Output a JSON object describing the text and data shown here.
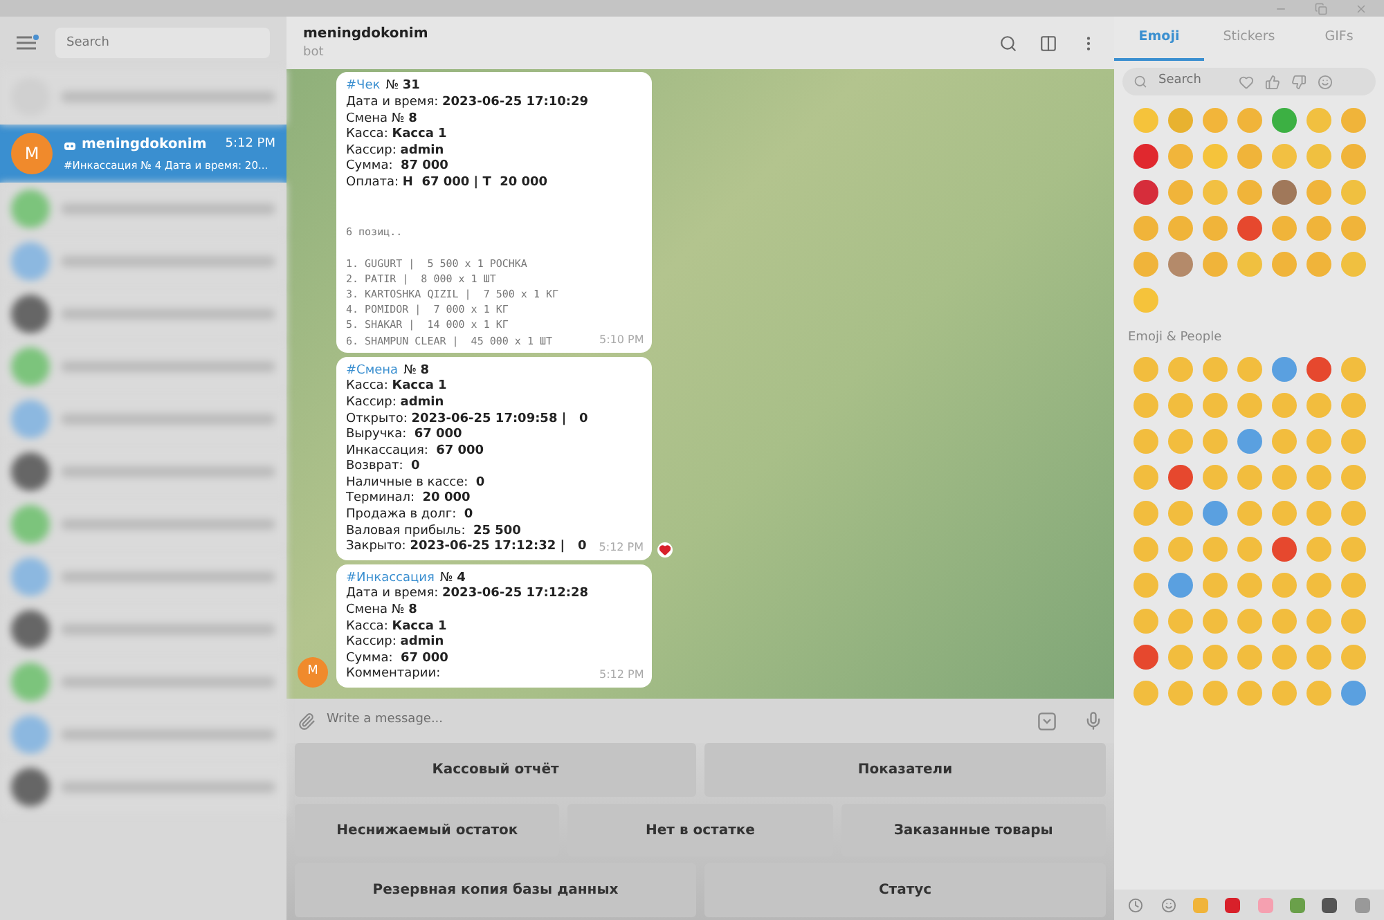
{
  "sidebar": {
    "search": {
      "placeholder": "Search"
    },
    "chats": [
      {
        "name": "meningdokonim",
        "avatar": "M",
        "time": "5:12 PM",
        "preview": "#Инкассация № 4 Дата и время: 20...",
        "selected": true
      }
    ]
  },
  "chat": {
    "title": "meningdokonim",
    "subtitle": "bot",
    "messages": [
      {
        "hashtag": "#Чек",
        "lines": [
          {
            "kind": "text",
            "text": "№ **31**"
          },
          {
            "kind": "text",
            "text": "Дата и время: **2023-06-25 17:10:29**"
          },
          {
            "kind": "text",
            "text": "Смена № **8**"
          },
          {
            "kind": "text",
            "text": "Касса: **Касса 1**"
          },
          {
            "kind": "text",
            "text": "Кассир: **admin**"
          },
          {
            "kind": "text",
            "text": "Сумма:  **87 000**"
          },
          {
            "kind": "text",
            "text": "Оплата: **Н  67 000 | Т  20 000**"
          },
          {
            "kind": "blank"
          },
          {
            "kind": "blank"
          },
          {
            "kind": "mono",
            "text": "6 позиц.."
          },
          {
            "kind": "blank"
          },
          {
            "kind": "mono",
            "text": "1. GUGURT |  5 500 x 1 РОСНКА"
          },
          {
            "kind": "mono",
            "text": "2. PATIR |  8 000 x 1 ШТ"
          },
          {
            "kind": "mono",
            "text": "3. KARTOSHKA QIZIL |  7 500 x 1 КГ"
          },
          {
            "kind": "mono",
            "text": "4. POMIDOR |  7 000 x 1 КГ"
          },
          {
            "kind": "mono",
            "text": "5. SHAKAR |  14 000 x 1 КГ"
          },
          {
            "kind": "mono",
            "text": "6. SHAMPUN CLEAR |  45 000 x 1 ШТ"
          }
        ],
        "time": "5:10 PM",
        "reaction": false
      },
      {
        "hashtag": "#Смена",
        "lines": [
          {
            "kind": "text",
            "text": "№ **8**"
          },
          {
            "kind": "text",
            "text": "Касса: **Касса 1**"
          },
          {
            "kind": "text",
            "text": "Кассир: **admin**"
          },
          {
            "kind": "text",
            "text": "Открыто: **2023-06-25 17:09:58 |   0**"
          },
          {
            "kind": "text",
            "text": "Выручка:  **67 000**"
          },
          {
            "kind": "text",
            "text": "Инкассация:  **67 000**"
          },
          {
            "kind": "text",
            "text": "Возврат:  **0**"
          },
          {
            "kind": "text",
            "text": "Наличные в кассе:  **0**"
          },
          {
            "kind": "text",
            "text": "Терминал:  **20 000**"
          },
          {
            "kind": "text",
            "text": "Продажа в долг:  **0**"
          },
          {
            "kind": "text",
            "text": "Валовая прибыль:  **25 500**"
          },
          {
            "kind": "text",
            "text": "Закрыто: **2023-06-25 17:12:32 |   0**"
          }
        ],
        "time": "5:12 PM",
        "reaction": true
      },
      {
        "hashtag": "#Инкассация",
        "lines": [
          {
            "kind": "text",
            "text": "№ **4**"
          },
          {
            "kind": "text",
            "text": "Дата и время: **2023-06-25 17:12:28**"
          },
          {
            "kind": "text",
            "text": "Смена № **8**"
          },
          {
            "kind": "text",
            "text": "Касса: **Касса 1**"
          },
          {
            "kind": "text",
            "text": "Кассир: **admin**"
          },
          {
            "kind": "text",
            "text": "Сумма:  **67 000**"
          },
          {
            "kind": "text",
            "text": "Комментарии:"
          }
        ],
        "time": "5:12 PM",
        "reaction": false,
        "avatar": "M"
      }
    ],
    "input": {
      "placeholder": "Write a message..."
    },
    "keyboard": [
      [
        "Кассовый отчёт",
        "Показатели"
      ],
      [
        "Неснижаемый остаток",
        "Нет в остатке",
        "Заказанные товары"
      ],
      [
        "Резервная копия базы данных",
        "Статус"
      ]
    ]
  },
  "panel": {
    "tabs": [
      {
        "label": "Emoji",
        "selected": true
      },
      {
        "label": "Stickers",
        "selected": false
      },
      {
        "label": "GIFs",
        "selected": false
      }
    ],
    "search": {
      "placeholder": "Search"
    },
    "section": "Emoji & People"
  }
}
